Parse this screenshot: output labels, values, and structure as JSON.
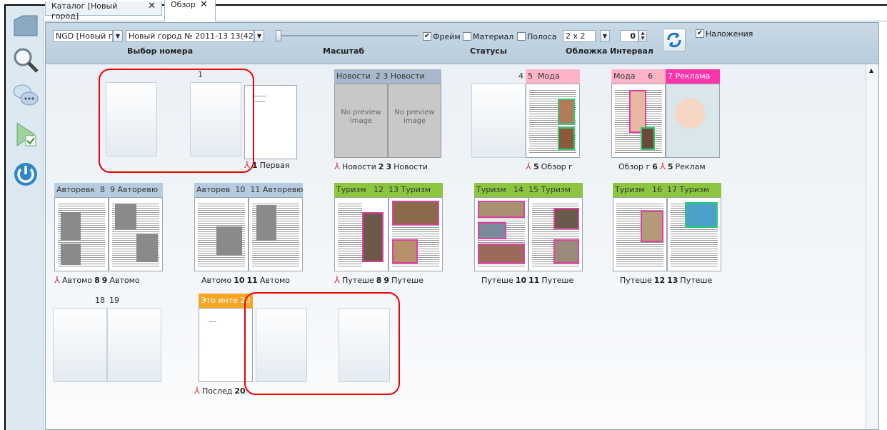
{
  "tabs": [
    {
      "label": "Каталог [Новый город]",
      "close": "✕"
    },
    {
      "label": "Обзор",
      "close": "✕"
    }
  ],
  "toolbar": {
    "edition_select": "NGD [Новый г",
    "issue_select": "Новый город № 2011-13 13(42",
    "cb_frame": "Фрейм",
    "cb_material": "Материал",
    "cb_stripe": "Полоса",
    "grid_select": "2 x 2",
    "interval_value": "0",
    "cb_overlays": "Наложения",
    "label_issue": "Выбор номера",
    "label_scale": "Масштаб",
    "label_statuses": "Статусы",
    "label_cover": "Обложка",
    "label_interval": "Интервал"
  },
  "spreads": [
    {
      "hdr_left": "",
      "hdr_left_num": "",
      "hdr_right_num": "1",
      "hdr_right": "",
      "cap_left": "",
      "cap_left_num": "",
      "cap_right_num": "1",
      "cap_right": "Первая",
      "no_preview": "No preview image"
    },
    {
      "hdr_left": "Новости",
      "hdr_left_num": "2",
      "hdr_right_num": "3",
      "hdr_right": "Новости",
      "cap_left": "Новости",
      "cap_left_num": "2",
      "cap_right_num": "3",
      "cap_right": "Новости",
      "no_preview": "No preview image"
    },
    {
      "hdr_left": "",
      "hdr_left_num": "4",
      "hdr_right_num": "5",
      "hdr_right": "Мода",
      "cap_left": "",
      "cap_left_num": "",
      "cap_right_num": "5",
      "cap_right": "Обзор г"
    },
    {
      "hdr_left": "Мода",
      "hdr_left_num": "6",
      "hdr_right_num": "7",
      "hdr_right": "Реклама",
      "cap_left": "Обзор г",
      "cap_left_num": "6",
      "cap_right_num": "5",
      "cap_right": "Реклам"
    },
    {
      "hdr_left": "Авторевк",
      "hdr_left_num": "8",
      "hdr_right_num": "9",
      "hdr_right": "Авторевю",
      "cap_left": "Автомо",
      "cap_left_num": "8",
      "cap_right_num": "9",
      "cap_right": "Автомо"
    },
    {
      "hdr_left": "Авторев",
      "hdr_left_num": "10",
      "hdr_right_num": "11",
      "hdr_right": "Авторевю",
      "cap_left": "Автомо",
      "cap_left_num": "10",
      "cap_right_num": "11",
      "cap_right": "Автомо"
    },
    {
      "hdr_left": "Туризм",
      "hdr_left_num": "12",
      "hdr_right_num": "13",
      "hdr_right": "Туризм",
      "cap_left": "Путеше",
      "cap_left_num": "8",
      "cap_right_num": "9",
      "cap_right": "Путеше"
    },
    {
      "hdr_left": "Туризм",
      "hdr_left_num": "14",
      "hdr_right_num": "15",
      "hdr_right": "Туризм",
      "cap_left": "Путеше",
      "cap_left_num": "10",
      "cap_right_num": "11",
      "cap_right": "Путеше"
    },
    {
      "hdr_left": "Туризм",
      "hdr_left_num": "16",
      "hdr_right_num": "17",
      "hdr_right": "Туризм",
      "cap_left": "Путеше",
      "cap_left_num": "12",
      "cap_right_num": "13",
      "cap_right": "Путеше"
    },
    {
      "hdr_left": "",
      "hdr_left_num": "18",
      "hdr_right_num": "19",
      "hdr_right": ""
    },
    {
      "hdr_left": "Это инте",
      "hdr_left_num": "20",
      "hdr_right_num": "",
      "hdr_right": "",
      "cap_left": "Послед",
      "cap_left_num": "20"
    }
  ],
  "colors": {
    "news": "#a8b8cc",
    "fashion": "#ffb3c6",
    "ads": "#ff33aa",
    "auto": "#b7cbe0",
    "tourism": "#8cc63f",
    "orange": "#f5a623",
    "highlight": "#e00000"
  }
}
